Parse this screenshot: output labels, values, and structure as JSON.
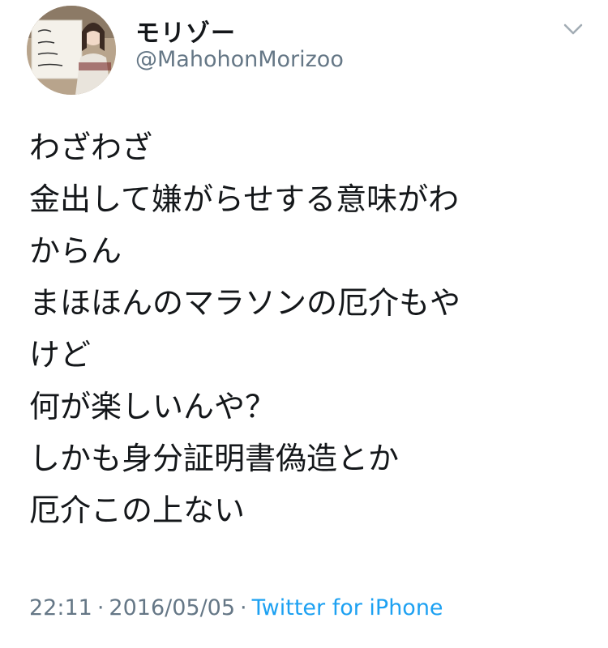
{
  "user": {
    "display_name": "モリゾー",
    "handle": "@MahohonMorizoo",
    "avatar_icon": "profile-photo"
  },
  "tweet": {
    "lines": [
      "わざわざ",
      "金出して嫌がらせする意味がわ",
      "からん",
      "まほほんのマラソンの厄介もや",
      "けど",
      "何が楽しいんや？",
      "しかも身分証明書偽造とか",
      "厄介この上ない"
    ],
    "time": "22:11",
    "date": "2016/05/05",
    "separator": "·",
    "source": "Twitter for iPhone"
  },
  "colors": {
    "text": "#14171a",
    "secondary": "#657786",
    "link": "#1da1f2"
  }
}
